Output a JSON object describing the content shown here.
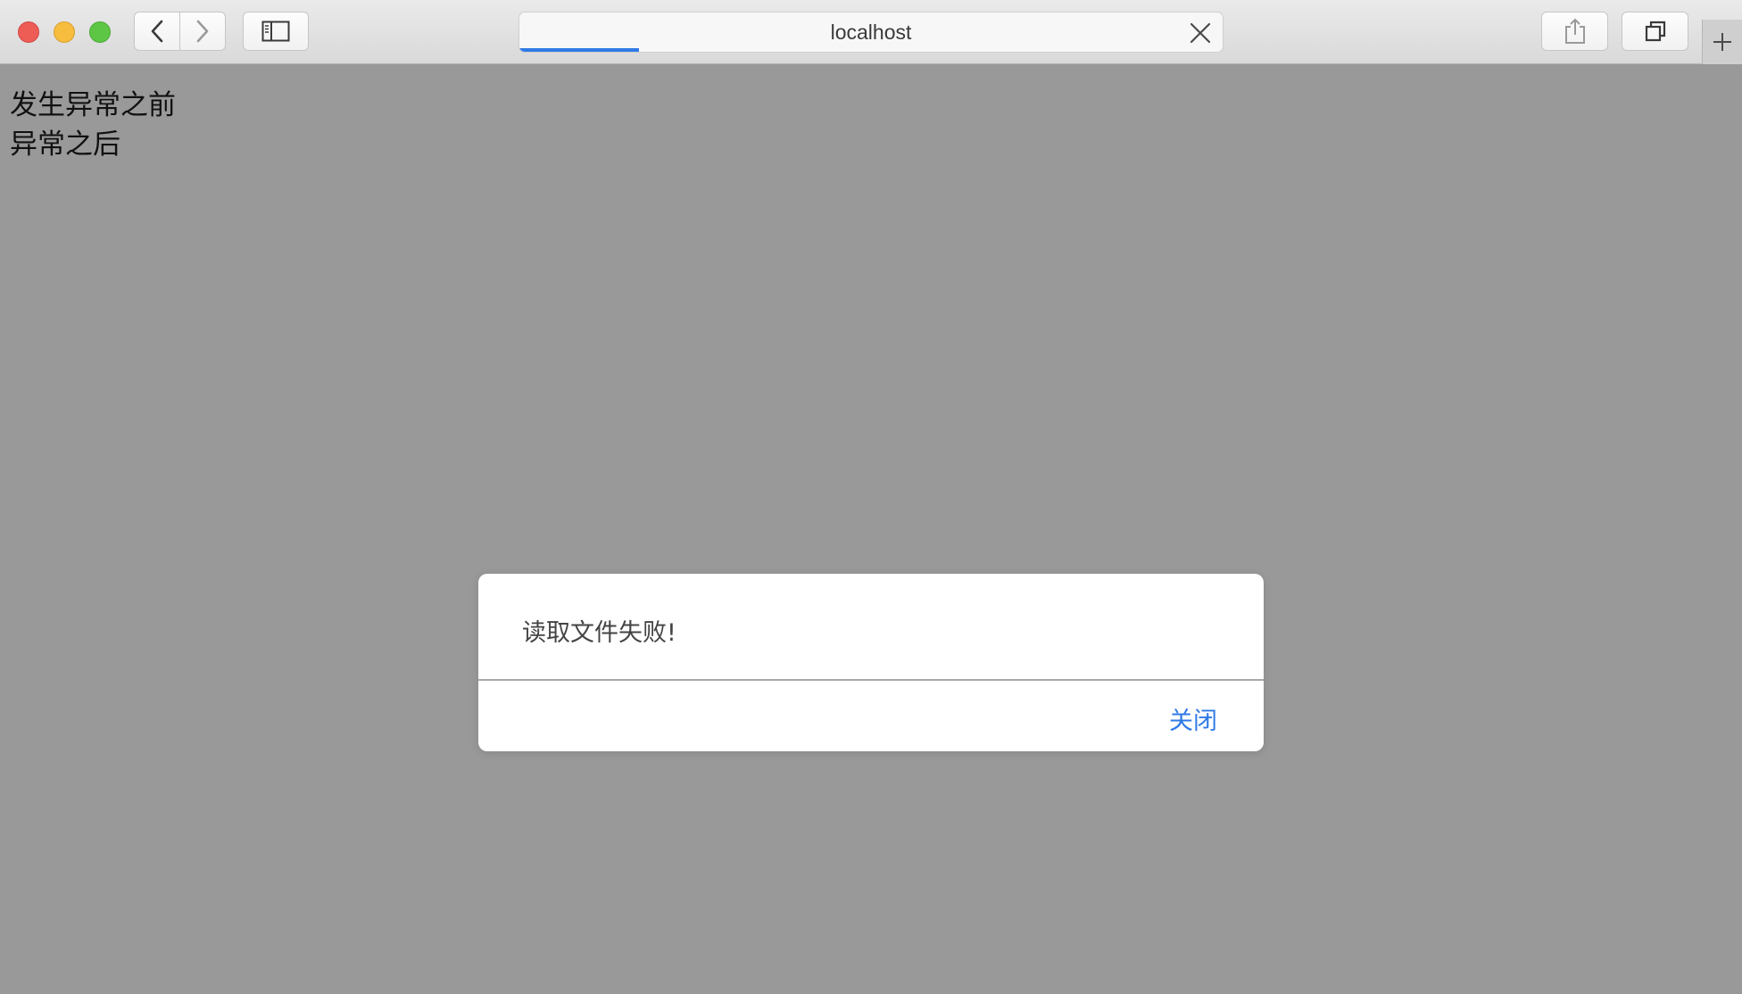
{
  "browser": {
    "url": "localhost",
    "load_progress": 0.17,
    "accent_color": "#2f7ae5"
  },
  "page": {
    "lines": [
      "发生异常之前",
      "异常之后"
    ]
  },
  "dialog": {
    "message": "读取文件失败!",
    "close_label": "关闭"
  },
  "icons": {
    "back": "chevron-left-icon",
    "forward": "chevron-right-icon",
    "sidebar": "sidebar-icon",
    "stop": "close-icon",
    "share": "share-icon",
    "tabs": "tabs-overview-icon",
    "new_tab": "plus-icon"
  }
}
